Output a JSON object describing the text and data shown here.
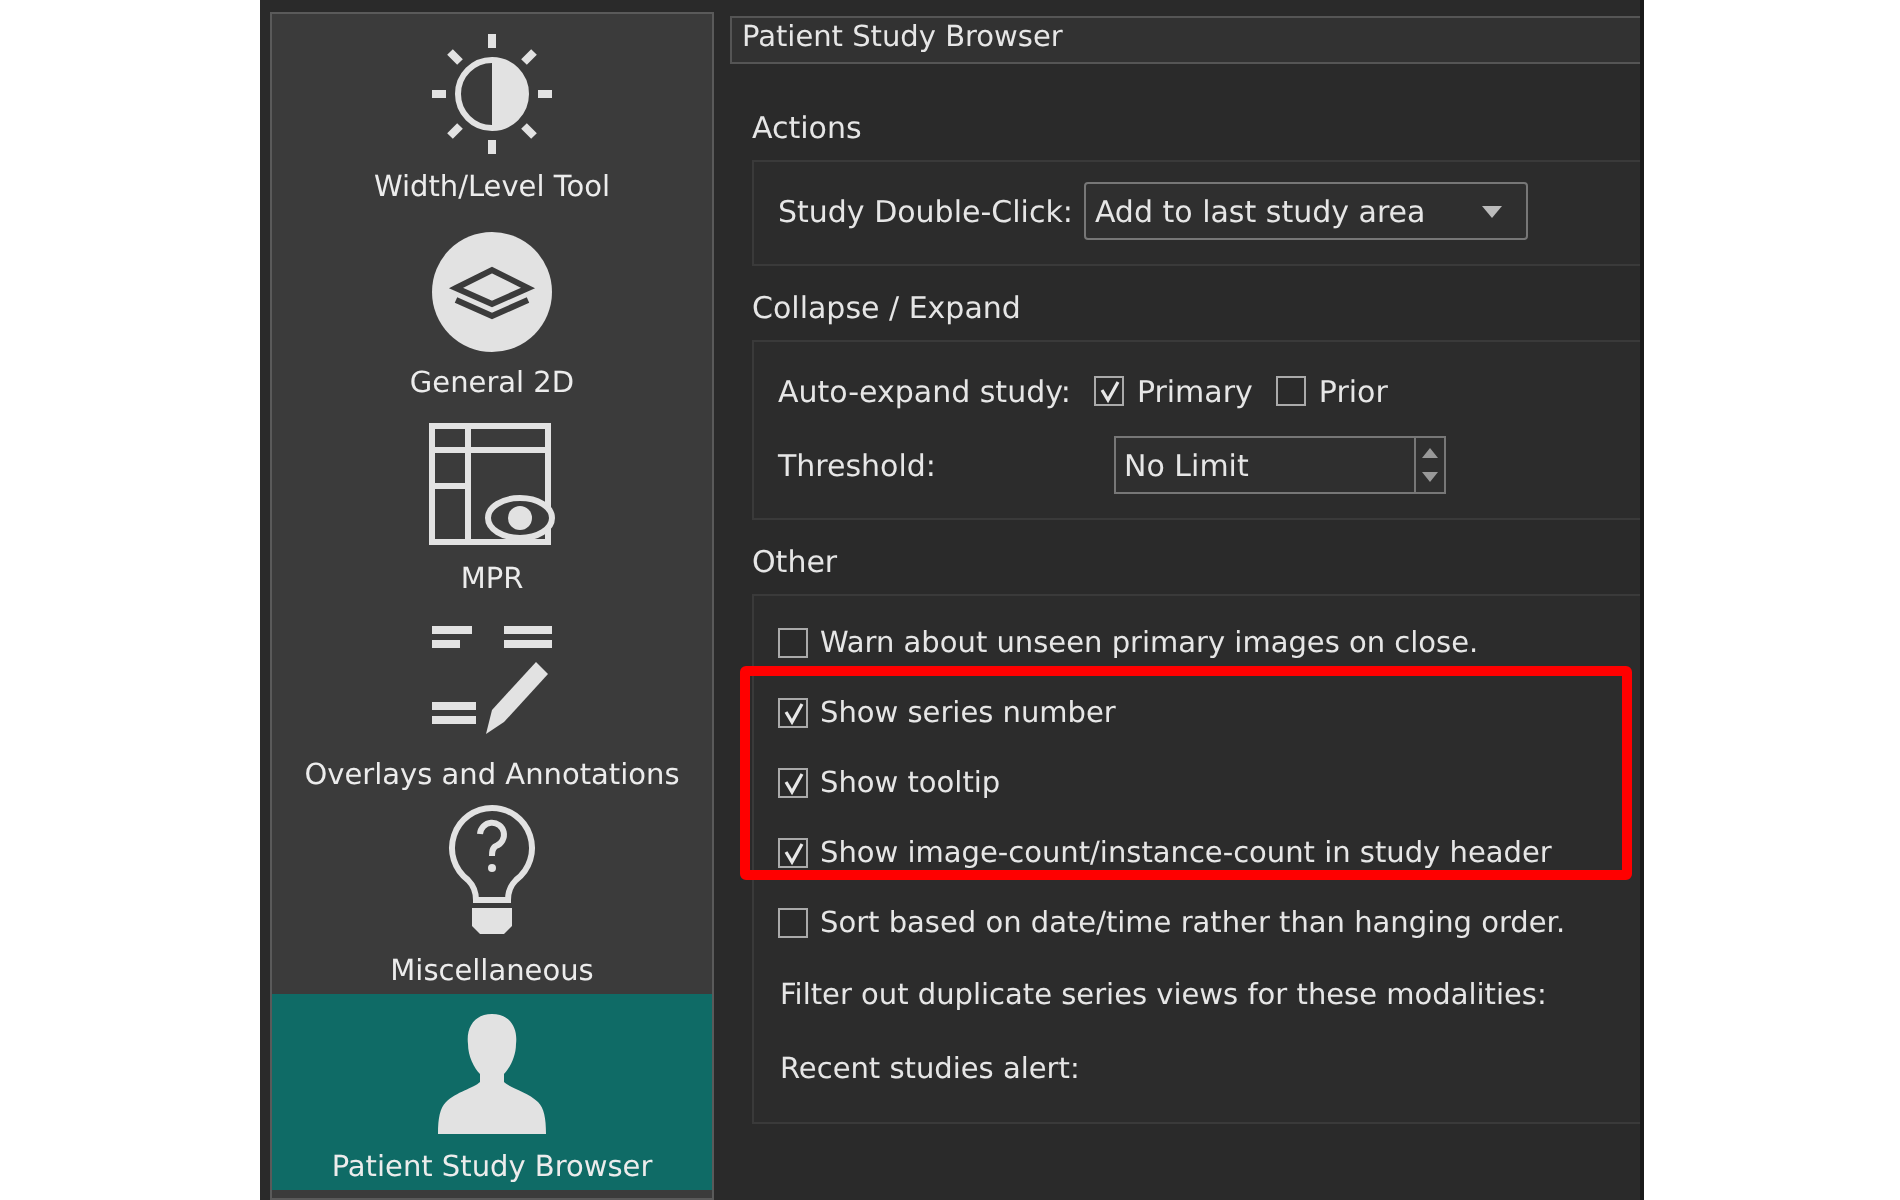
{
  "sidebar": {
    "items": [
      {
        "label": "Width/Level Tool",
        "selected": false
      },
      {
        "label": "General 2D",
        "selected": false
      },
      {
        "label": "MPR",
        "selected": false
      },
      {
        "label": "Overlays and Annotations",
        "selected": false
      },
      {
        "label": "Miscellaneous",
        "selected": false
      },
      {
        "label": "Patient Study Browser",
        "selected": true
      }
    ]
  },
  "panel": {
    "title": "Patient Study Browser",
    "sections": [
      {
        "title": "Actions",
        "rows": [
          {
            "kind": "dropdown",
            "label": "Study Double-Click:",
            "value": "Add to last study area"
          }
        ]
      },
      {
        "title": "Collapse / Expand",
        "rows": [
          {
            "kind": "checks",
            "label": "Auto-expand study:",
            "options": [
              {
                "label": "Primary",
                "checked": true
              },
              {
                "label": "Prior",
                "checked": false
              }
            ]
          },
          {
            "kind": "spin",
            "label": "Threshold:",
            "value": "No Limit"
          }
        ]
      },
      {
        "title": "Other",
        "rows": [
          {
            "kind": "checkbox",
            "label": "Warn about unseen primary images on close.",
            "checked": false
          },
          {
            "kind": "checkbox",
            "label": "Show series number",
            "checked": true
          },
          {
            "kind": "checkbox",
            "label": "Show tooltip",
            "checked": true
          },
          {
            "kind": "checkbox",
            "label": "Show image-count/instance-count in study header",
            "checked": true
          },
          {
            "kind": "checkbox",
            "label": "Sort based on date/time rather than hanging order.",
            "checked": false
          },
          {
            "kind": "text",
            "label": "Filter out duplicate series views for these modalities:"
          },
          {
            "kind": "text",
            "label": "Recent studies alert:"
          }
        ]
      }
    ]
  }
}
